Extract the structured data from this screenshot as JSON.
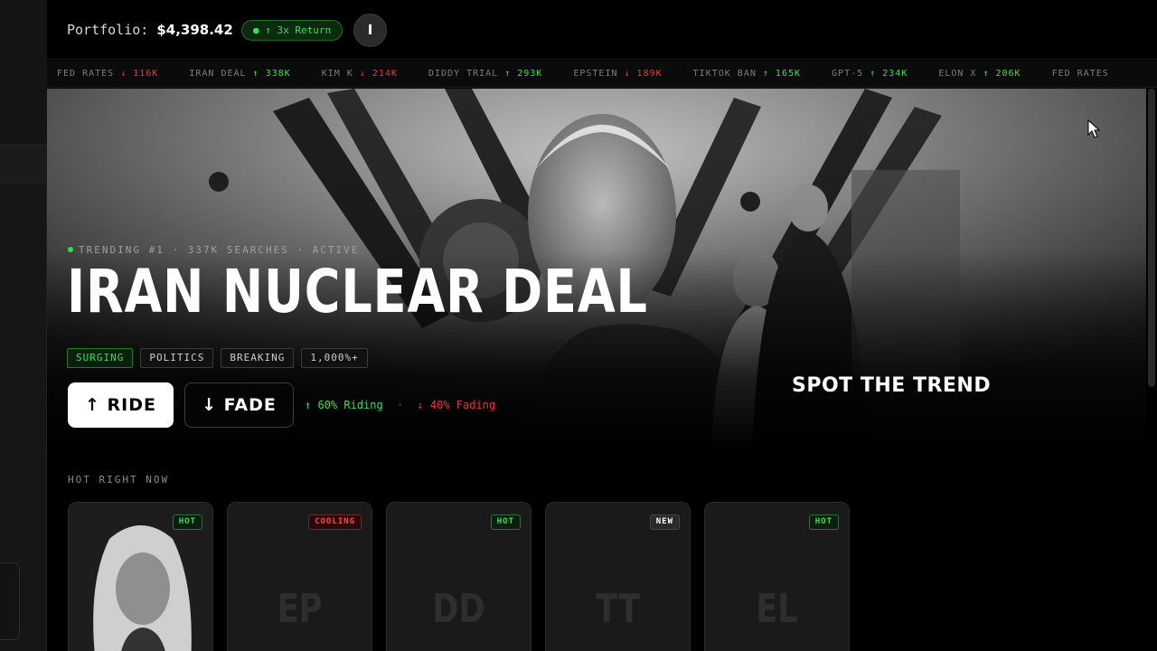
{
  "header": {
    "portfolio_label": "Portfolio:",
    "portfolio_value": "$4,398.42",
    "return_pill": "● ↑ 3x Return",
    "avatar_initial": "I"
  },
  "ticker": [
    {
      "name": "FED RATES",
      "dir": "↓",
      "value": "116K",
      "trend": "down"
    },
    {
      "name": "IRAN DEAL",
      "dir": "↑",
      "value": "338K",
      "trend": "up"
    },
    {
      "name": "KIM K",
      "dir": "↓",
      "value": "214K",
      "trend": "down"
    },
    {
      "name": "DIDDY TRIAL",
      "dir": "↑",
      "value": "293K",
      "trend": "up"
    },
    {
      "name": "EPSTEIN",
      "dir": "↓",
      "value": "189K",
      "trend": "down"
    },
    {
      "name": "TIKTOK BAN",
      "dir": "↑",
      "value": "165K",
      "trend": "up"
    },
    {
      "name": "GPT-5",
      "dir": "↑",
      "value": "234K",
      "trend": "up"
    },
    {
      "name": "ELON X",
      "dir": "↑",
      "value": "206K",
      "trend": "up"
    },
    {
      "name": "FED RATES",
      "dir": "",
      "value": "",
      "trend": "down"
    }
  ],
  "hero": {
    "meta": "TRENDING #1 · 337K SEARCHES · ACTIVE",
    "title": "IRAN NUCLEAR DEAL",
    "tags": [
      "SURGING",
      "POLITICS",
      "BREAKING",
      "1,000%+"
    ],
    "ride_label": "↑ RIDE",
    "fade_label": "↓ FADE",
    "riding": "↑ 60% Riding",
    "separator": "·",
    "fading": "↓ 40% Fading",
    "overlay_text": "SPOT THE TREND"
  },
  "hot": {
    "title": "HOT RIGHT NOW",
    "cards": [
      {
        "badge": "HOT",
        "badge_type": "hot",
        "initials": ""
      },
      {
        "badge": "COOLING",
        "badge_type": "cooling",
        "initials": "EP"
      },
      {
        "badge": "HOT",
        "badge_type": "hot",
        "initials": "DD"
      },
      {
        "badge": "NEW",
        "badge_type": "new",
        "initials": "TT"
      },
      {
        "badge": "HOT",
        "badge_type": "hot",
        "initials": "EL"
      }
    ]
  },
  "colors": {
    "accent_green": "#3ddc57",
    "accent_red": "#e33a3a",
    "background": "#000000"
  },
  "icons": [
    "arrow-up-icon",
    "arrow-down-icon",
    "mouse-cursor-icon",
    "status-dot-icon"
  ]
}
